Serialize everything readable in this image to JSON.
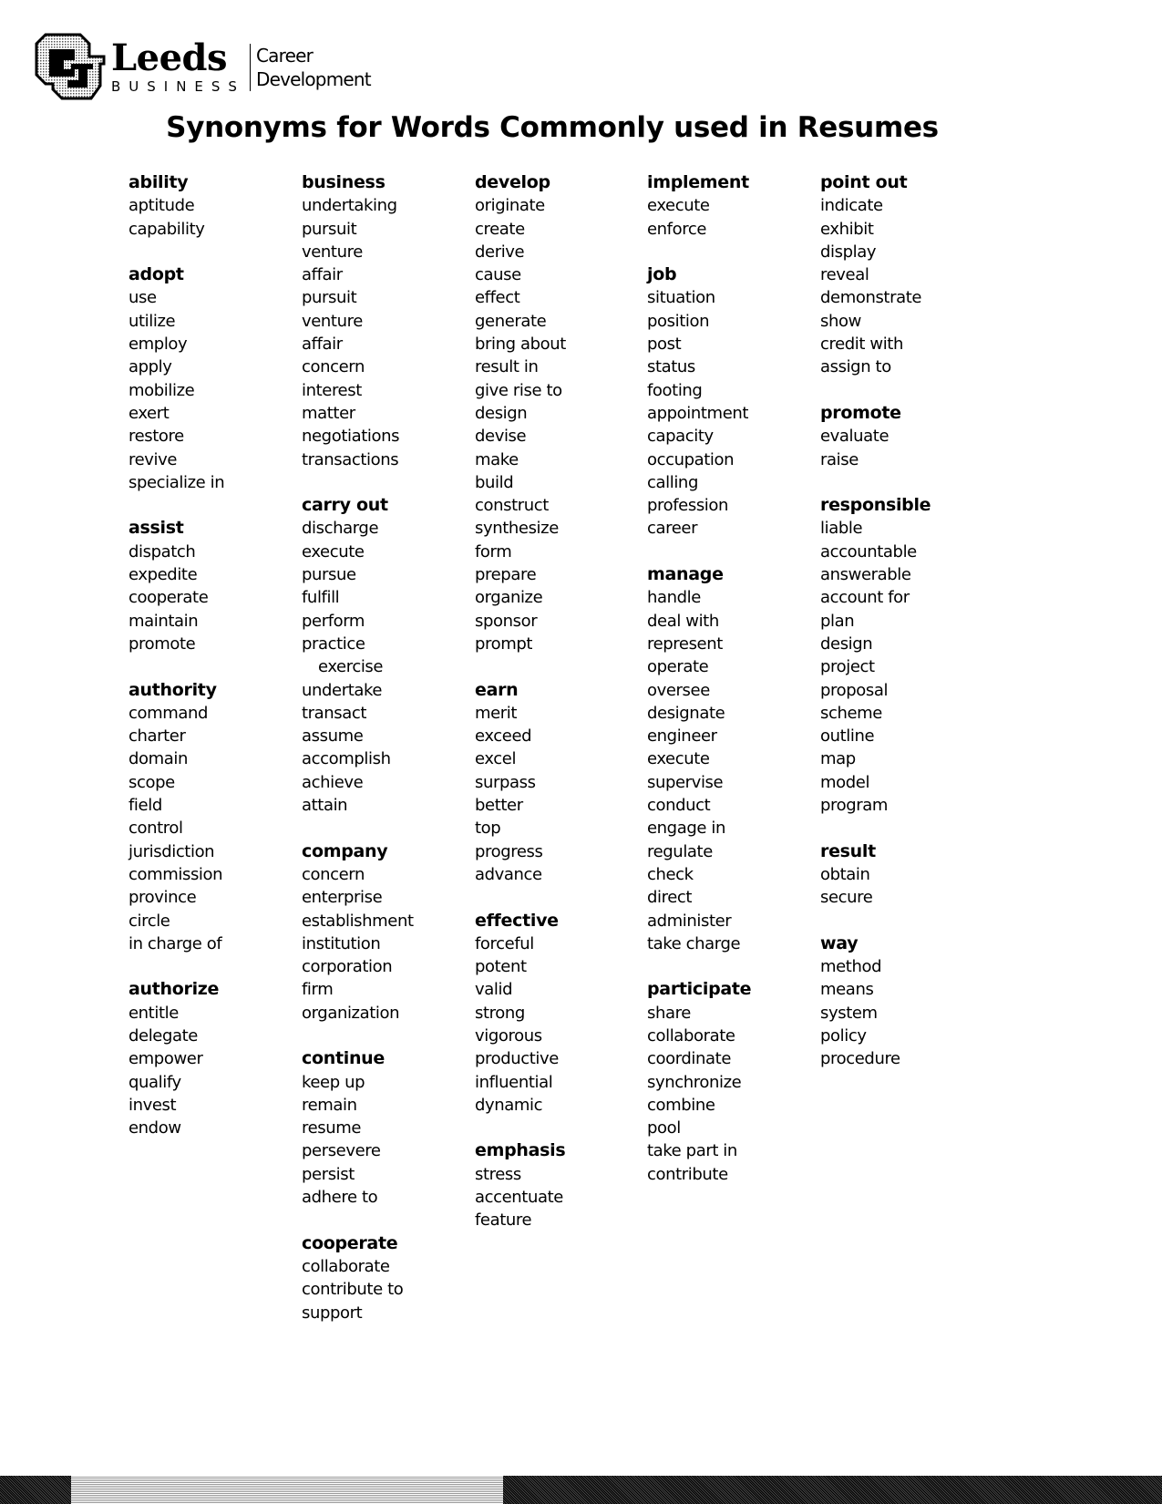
{
  "header": {
    "logo_icon": "cu-interlocking-logo",
    "brand_name": "Leeds",
    "brand_sub": "BUSINESS",
    "department_line1": "Career",
    "department_line2": "Development"
  },
  "title": "Synonyms for Words Commonly used in Resumes",
  "columns": [
    [
      {
        "word": "ability",
        "synonyms": [
          "aptitude",
          "capability"
        ]
      },
      {
        "word": "adopt",
        "synonyms": [
          "use",
          "utilize",
          "employ",
          "apply",
          "mobilize",
          "exert",
          "restore",
          "revive",
          "specialize in"
        ]
      },
      {
        "word": "assist",
        "synonyms": [
          "dispatch",
          "expedite",
          "cooperate",
          "maintain",
          "promote"
        ]
      },
      {
        "word": "authority",
        "synonyms": [
          "command",
          "charter",
          "domain",
          "scope",
          "field",
          "control",
          "jurisdiction",
          "commission",
          "province",
          "circle",
          "in charge of"
        ]
      },
      {
        "word": "authorize",
        "synonyms": [
          "entitle",
          "delegate",
          "empower",
          "qualify",
          "invest",
          "endow"
        ]
      }
    ],
    [
      {
        "word": "business",
        "synonyms": [
          "undertaking",
          "pursuit",
          "venture",
          "affair",
          "pursuit",
          "venture",
          "affair",
          "concern",
          "interest",
          "matter",
          "negotiations",
          "transactions"
        ]
      },
      {
        "word": "carry out",
        "synonyms": [
          "discharge",
          "execute",
          "pursue",
          "fulfill",
          "perform",
          "practice",
          "exercise",
          "undertake",
          "transact",
          "assume",
          "accomplish",
          "achieve",
          "attain"
        ]
      },
      {
        "word": "company",
        "synonyms": [
          "concern",
          "enterprise",
          "establishment",
          "institution",
          "corporation",
          "firm",
          "organization"
        ]
      },
      {
        "word": "continue",
        "synonyms": [
          "keep up",
          "remain",
          "resume",
          "persevere",
          "persist",
          "adhere to"
        ]
      },
      {
        "word": "cooperate",
        "synonyms": [
          "collaborate",
          "contribute to",
          "support"
        ]
      }
    ],
    [
      {
        "word": "develop",
        "synonyms": [
          "originate",
          "create",
          "derive",
          "cause",
          "effect",
          "generate",
          "bring about",
          "result in",
          "give rise to",
          "design",
          "devise",
          "make",
          "build",
          "construct",
          "synthesize",
          "form",
          "prepare",
          "organize",
          "sponsor",
          "prompt"
        ]
      },
      {
        "word": "earn",
        "synonyms": [
          "merit",
          "exceed",
          "excel",
          "surpass",
          "better",
          "top",
          "progress",
          "advance"
        ]
      },
      {
        "word": "effective",
        "synonyms": [
          "forceful",
          "potent",
          "valid",
          "strong",
          "vigorous",
          "productive",
          "influential",
          "dynamic"
        ]
      },
      {
        "word": "emphasis",
        "synonyms": [
          "stress",
          "accentuate",
          "feature"
        ]
      }
    ],
    [
      {
        "word": "implement",
        "synonyms": [
          "execute",
          "enforce"
        ]
      },
      {
        "word": "job",
        "synonyms": [
          "situation",
          "position",
          "post",
          "status",
          "footing",
          "appointment",
          "capacity",
          "occupation",
          "calling",
          "profession",
          "career"
        ]
      },
      {
        "word": "manage",
        "synonyms": [
          "handle",
          "deal with",
          "represent",
          "operate",
          "oversee",
          "designate",
          "engineer",
          "execute",
          "supervise",
          "conduct",
          "engage in",
          "regulate",
          "check",
          "direct",
          "administer",
          "take charge"
        ]
      },
      {
        "word": "participate",
        "synonyms": [
          "share",
          "collaborate",
          "coordinate",
          "synchronize",
          "combine",
          "pool",
          "take part in",
          "contribute"
        ]
      }
    ],
    [
      {
        "word": "point out",
        "synonyms": [
          "indicate",
          "exhibit",
          "display",
          "reveal",
          "demonstrate",
          "show",
          "credit with",
          "assign to"
        ]
      },
      {
        "word": "promote",
        "synonyms": [
          "evaluate",
          "raise"
        ]
      },
      {
        "word": "responsible",
        "synonyms": [
          "liable",
          "accountable",
          "answerable",
          "account for",
          "plan",
          "design",
          "project",
          "proposal",
          "scheme",
          "outline",
          "map",
          "model",
          "program"
        ]
      },
      {
        "word": "result",
        "synonyms": [
          "obtain",
          "secure"
        ]
      },
      {
        "word": "way",
        "synonyms": [
          "method",
          "means",
          "system",
          "policy",
          "procedure"
        ]
      }
    ]
  ],
  "indented_items": [
    "exercise"
  ],
  "footer": {
    "colors": {
      "dark": "#222222",
      "light": "#cfcfcf"
    }
  }
}
